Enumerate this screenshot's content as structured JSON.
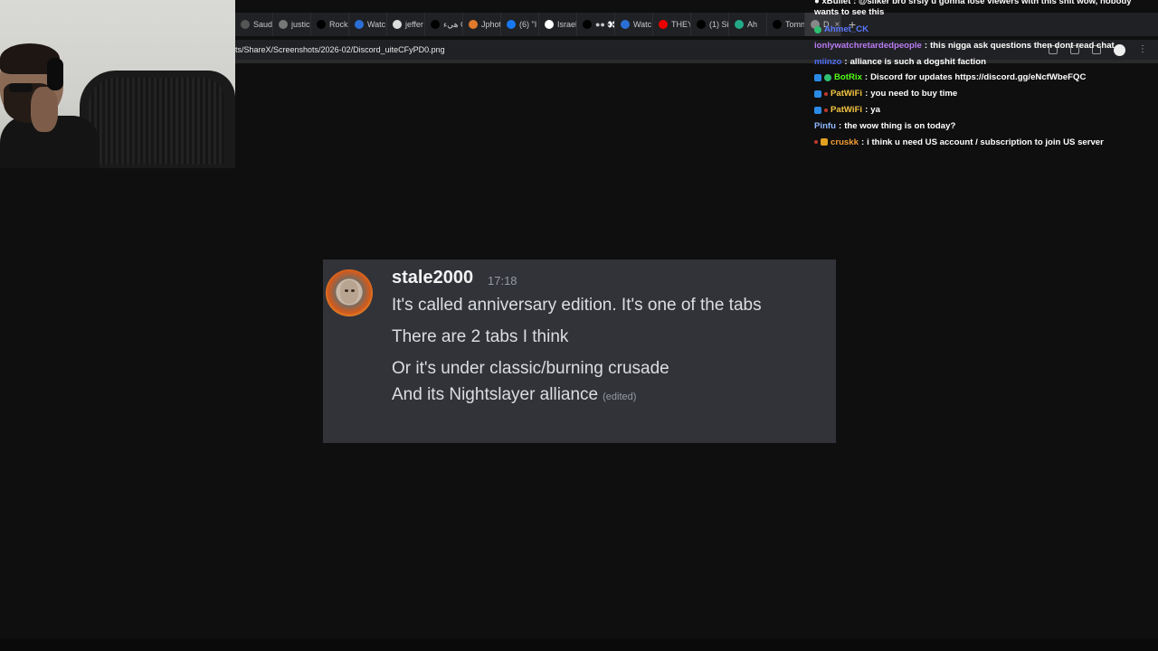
{
  "browser": {
    "tabs": [
      {
        "label": "Saudi",
        "icon": "page-icon",
        "color": "#555"
      },
      {
        "label": "justic",
        "icon": "site-icon",
        "color": "#777"
      },
      {
        "label": "Rock",
        "icon": "x-icon",
        "color": "#000"
      },
      {
        "label": "Watc",
        "icon": "globe-icon",
        "color": "#2b6fd6"
      },
      {
        "label": "jeffer",
        "icon": "google-icon",
        "color": "#ddd"
      },
      {
        "label": "هيء C",
        "icon": "x-icon",
        "color": "#000"
      },
      {
        "label": "Jphot",
        "icon": "pinwheel-icon",
        "color": "#e07a2a"
      },
      {
        "label": "(6) \"I",
        "icon": "facebook-icon",
        "color": "#1877f2"
      },
      {
        "label": "Israel",
        "icon": "wikipedia-icon",
        "color": "#fff"
      },
      {
        "label": "●● 👀",
        "icon": "x-icon",
        "color": "#000"
      },
      {
        "label": "Watc",
        "icon": "globe-icon",
        "color": "#2b6fd6"
      },
      {
        "label": "THEY",
        "icon": "youtube-icon",
        "color": "#e00"
      },
      {
        "label": "(1) Si",
        "icon": "x-icon",
        "color": "#000"
      },
      {
        "label": "Ah",
        "icon": "ai-icon",
        "color": "#2a8"
      },
      {
        "label": "Tomn",
        "icon": "x-icon",
        "color": "#000"
      },
      {
        "label": "D",
        "icon": "globe-icon",
        "color": "#888",
        "active": true
      }
    ],
    "new_tab": "+",
    "url": "ts/ShareX/Screenshots/2026-02/Discord_uiteCFyPD0.png"
  },
  "chat": {
    "top_partial": "● xBullet : @sliker bro srsly u gonna lose viewers with this shit wow, nobody wants to see this",
    "messages": [
      {
        "user": "Ahmet_CK",
        "color": "#5a78ff",
        "text": "",
        "badges": [
          "green"
        ]
      },
      {
        "user": "ionlywatchretardedpeople",
        "color": "#b97cf2",
        "text": "this nigga ask questions then dont read chat",
        "badges": []
      },
      {
        "user": "miinzo",
        "color": "#4a6cf0",
        "text": "alliance is such a dogshit faction",
        "badges": []
      },
      {
        "user": "BotRix",
        "color": "#53fc18",
        "text": "Discord for updates https://discord.gg/eNcfWbeFQC",
        "badges": [
          "blue",
          "green"
        ]
      },
      {
        "user": "PatWiFi",
        "color": "#f5c542",
        "text": "you need to buy time",
        "badges": [
          "blue",
          "red"
        ]
      },
      {
        "user": "PatWiFi",
        "color": "#f5c542",
        "text": "ya",
        "badges": [
          "blue",
          "red"
        ]
      },
      {
        "user": "Pinfu",
        "color": "#8fb7ff",
        "text": "the wow thing is on today?",
        "badges": []
      },
      {
        "user": "cruskk",
        "color": "#f39c34",
        "text": "i think u need US account / subscription to join US server",
        "badges": [
          "red",
          "gold"
        ]
      }
    ]
  },
  "discord": {
    "username": "stale2000",
    "timestamp": "17:18",
    "lines": [
      "It's called anniversary edition. It's one of the tabs",
      "There are 2 tabs I think",
      "Or it's under classic/burning crusade",
      "And its Nightslayer alliance"
    ],
    "edited_label": "(edited)"
  }
}
